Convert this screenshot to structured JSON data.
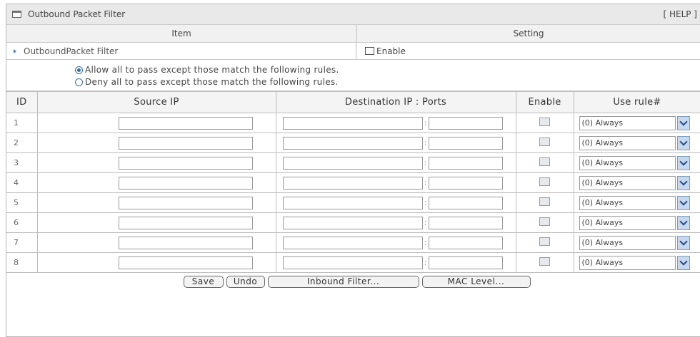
{
  "page": {
    "title": "Outbound Packet Filter",
    "help": "[ HELP ]"
  },
  "header": {
    "item": "Item",
    "setting": "Setting"
  },
  "filter_row": {
    "label": "OutboundPacket Filter",
    "enable_label": "Enable"
  },
  "modes": {
    "allow": "Allow all to pass except those match the following rules.",
    "deny": "Deny all to pass except those match the following rules.",
    "selected": "allow"
  },
  "table": {
    "columns": [
      "ID",
      "Source IP",
      "Destination IP : Ports",
      "Enable",
      "Use rule#"
    ],
    "rows": [
      {
        "id": "1",
        "rule": "(0) Always"
      },
      {
        "id": "2",
        "rule": "(0) Always"
      },
      {
        "id": "3",
        "rule": "(0) Always"
      },
      {
        "id": "4",
        "rule": "(0) Always"
      },
      {
        "id": "5",
        "rule": "(0) Always"
      },
      {
        "id": "6",
        "rule": "(0) Always"
      },
      {
        "id": "7",
        "rule": "(0) Always"
      },
      {
        "id": "8",
        "rule": "(0) Always"
      }
    ]
  },
  "buttons": {
    "save": "Save",
    "undo": "Undo",
    "inbound": "Inbound Filter...",
    "mac": "MAC Level..."
  }
}
